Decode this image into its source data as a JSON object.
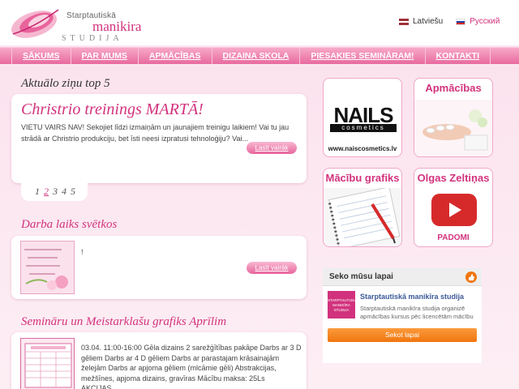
{
  "brand": {
    "line1": "Starptautiskā",
    "line2": "manikira",
    "line3": "STUDIJA"
  },
  "languages": [
    {
      "label": "Latviešu"
    },
    {
      "label": "Русский"
    }
  ],
  "nav": {
    "items": [
      "SĀKUMS",
      "PAR MUMS",
      "APMĀCĪBAS",
      "DIZAINA SKOLA",
      "PIESAKIES SEMINĀRAM!",
      "KONTAKTI"
    ]
  },
  "news": {
    "section_title": "Aktuālo ziņu top 5",
    "card_title": "Christrio treinings MARTĀ!",
    "card_text": "VIETU VAIRS NAV! Sekojiet līdzi izmaiņām un jaunajiem treinigu laikiem! Vai tu jau strādā ar Christrio produkciju, bet īsti neesi izpratusi tehnoloģiju? Vai...",
    "read_more": "Lasīt vairāk",
    "pager": [
      "1",
      "2",
      "3",
      "4",
      "5"
    ],
    "pager_current": "2"
  },
  "holiday": {
    "section_title": "Darba laiks svētkos",
    "text": "!",
    "read_more": "Lasīt vairāk"
  },
  "seminars": {
    "section_title": "Semināru un Meistarklašu grafiks Aprīlim",
    "text": "03.04. 11:00-16:00 Gēla dizains 2 sarežģītības pakāpe Darbs ar 3 D gēliem Darbs ar 4 D gēliem Darbs ar parastajam krāsainajām želejām Darbs ar apjoma gēliem (mlcāmie gēli) Abstrakcijas, mežšīnes, apjoma dizains, gravīras Mācību maksa: 25Ls AKCIJAS..."
  },
  "promos": [
    {
      "title": "NAILS",
      "subtitle": "cosmetics",
      "url": "www.naiscosmetics.lv"
    },
    {
      "title": "Apmācības"
    },
    {
      "title": "Mācību grafiks"
    },
    {
      "title": "Olgas Zeltiņas",
      "caption": "PADOMI"
    }
  ],
  "facebook": {
    "header": "Seko mūsu lapai",
    "page_name": "Starptautiskā manikīra studija",
    "description": "Starptautiskā manikīra studija organizē apmācības kursus pēc licencētām mācību",
    "logo_text": "STARPTAUTISKĀ MANIKĪRA STUDIJA",
    "button": "Sekot lapai"
  },
  "colors": {
    "accent": "#d2327d",
    "nav_top": "#f7a9c8",
    "nav_bottom": "#e86a9f",
    "background": "#fbe6ef",
    "facebook_button": "#f0760f"
  }
}
